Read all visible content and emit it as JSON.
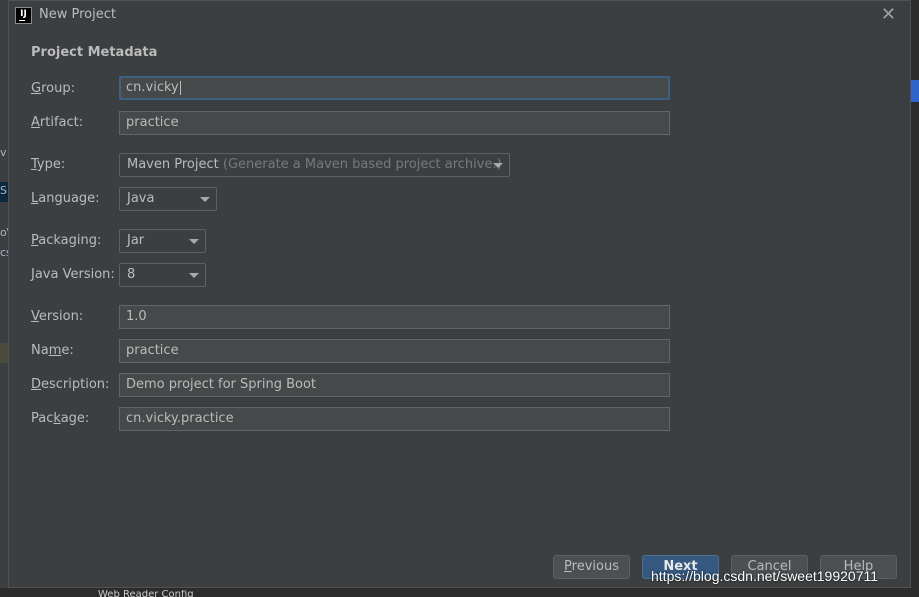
{
  "window": {
    "title": "New Project",
    "app_icon": "intellij-icon",
    "close_icon": "close-icon"
  },
  "section_title": "Project Metadata",
  "form": {
    "group": {
      "label_u": "G",
      "label_rest": "roup:",
      "value": "cn.vicky"
    },
    "artifact": {
      "label_u": "A",
      "label_rest": "rtifact:",
      "value": "practice"
    },
    "type": {
      "label_u": "T",
      "label_rest": "ype:",
      "value": "Maven Project",
      "hint": "(Generate a Maven based project archive.)"
    },
    "language": {
      "label_u": "L",
      "label_rest": "anguage:",
      "value": "Java"
    },
    "packaging": {
      "label_u": "P",
      "label_rest": "ackaging:",
      "value": "Jar"
    },
    "java_version": {
      "label_u": "J",
      "label_rest": "ava Version:",
      "value": "8"
    },
    "version": {
      "label_u": "V",
      "label_rest": "ersion:",
      "value": "1.0"
    },
    "name": {
      "label_pre": "Na",
      "label_u": "m",
      "label_rest": "e:",
      "value": "practice"
    },
    "description": {
      "label_u": "D",
      "label_rest": "escription:",
      "value": "Demo project for Spring Boot"
    },
    "package": {
      "label_pre": "Pac",
      "label_u": "k",
      "label_rest": "age:",
      "value": "cn.vicky.practice"
    }
  },
  "buttons": {
    "previous": {
      "u": "P",
      "rest": "revious"
    },
    "next": "Next",
    "cancel": "Cancel",
    "help": "Help"
  },
  "watermark": "https://blog.csdn.net/sweet19920711",
  "background": {
    "left_fragments": [
      "v",
      "S",
      "o\\",
      "cs"
    ],
    "bottom_text": "Web Reader Config"
  },
  "colors": {
    "dialog_bg": "#3c3f41",
    "field_bg": "#45494a",
    "focus_border": "#3d6185",
    "primary_button": "#365880"
  }
}
